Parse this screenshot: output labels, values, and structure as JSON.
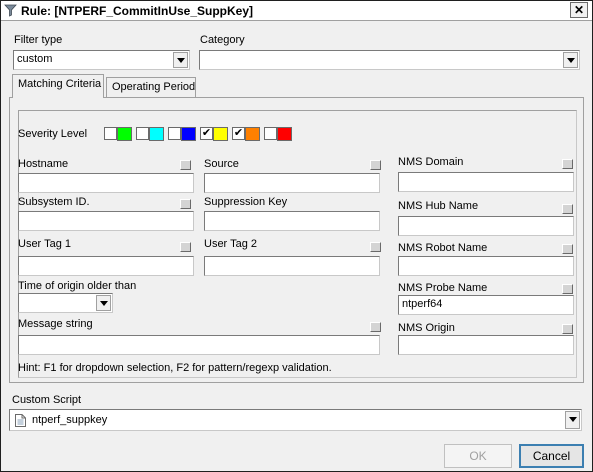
{
  "window": {
    "title": "Rule: [NTPERF_CommitInUse_SuppKey]",
    "close_label": "✕"
  },
  "filter_type": {
    "label": "Filter type",
    "value": "custom"
  },
  "category": {
    "label": "Category",
    "value": ""
  },
  "tabs": [
    {
      "label": "Matching Criteria",
      "active": true
    },
    {
      "label": "Operating Period",
      "active": false
    }
  ],
  "severity": {
    "label": "Severity Level",
    "levels": [
      {
        "color": "#00ff00",
        "checked": false
      },
      {
        "color": "#00ffff",
        "checked": false
      },
      {
        "color": "#0000ff",
        "checked": false
      },
      {
        "color": "#ffff00",
        "checked": true
      },
      {
        "color": "#ff8000",
        "checked": true
      },
      {
        "color": "#ff0000",
        "checked": false
      }
    ]
  },
  "fields": {
    "hostname": {
      "label": "Hostname",
      "value": ""
    },
    "source": {
      "label": "Source",
      "value": ""
    },
    "subsystem_id": {
      "label": "Subsystem ID.",
      "value": ""
    },
    "suppression_key": {
      "label": "Suppression Key",
      "value": ""
    },
    "user_tag_1": {
      "label": "User Tag 1",
      "value": ""
    },
    "user_tag_2": {
      "label": "User Tag 2",
      "value": ""
    },
    "time_of_origin": {
      "label": "Time of origin older than",
      "value": ""
    },
    "message_string": {
      "label": "Message string",
      "value": ""
    },
    "nms_domain": {
      "label": "NMS Domain",
      "value": ""
    },
    "nms_hub_name": {
      "label": "NMS Hub Name",
      "value": ""
    },
    "nms_robot_name": {
      "label": "NMS Robot Name",
      "value": ""
    },
    "nms_probe_name": {
      "label": "NMS Probe Name",
      "value": "ntperf64"
    },
    "nms_origin": {
      "label": "NMS Origin",
      "value": ""
    }
  },
  "hint": "Hint: F1 for dropdown selection, F2 for pattern/regexp validation.",
  "custom_script": {
    "label": "Custom Script",
    "value": "ntperf_suppkey"
  },
  "buttons": {
    "ok": "OK",
    "cancel": "Cancel"
  }
}
